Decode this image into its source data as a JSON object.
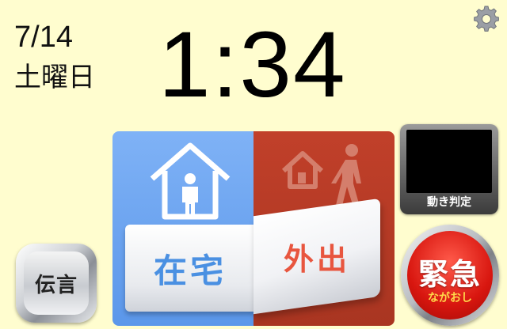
{
  "date": "7/14",
  "weekday": "土曜日",
  "clock": "1:34",
  "settings_icon": "gear-icon",
  "presence": {
    "home_label": "在宅",
    "out_label": "外出",
    "home_icon": "house-person-icon",
    "out_icon": "house-walking-person-icon",
    "home_color": "#5b97ea",
    "out_color": "#a93521",
    "state": "在宅"
  },
  "motion": {
    "label": "動き判定"
  },
  "message_button": {
    "label": "伝言"
  },
  "emergency_button": {
    "label": "緊急",
    "sub_label": "ながおし",
    "color": "#d8160f"
  }
}
